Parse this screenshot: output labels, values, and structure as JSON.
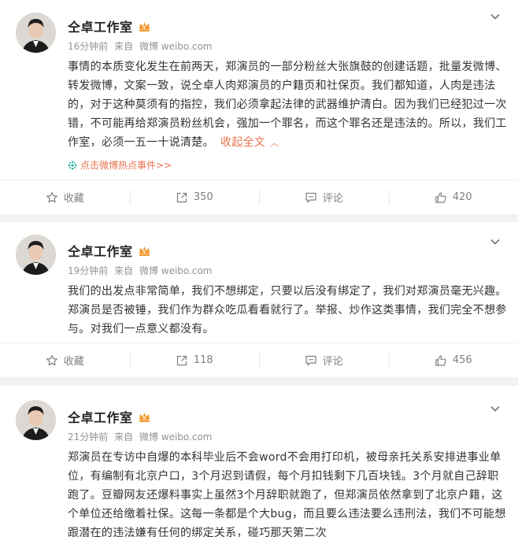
{
  "posts": [
    {
      "author": "仝卓工作室",
      "time": "16分钟前",
      "source_prefix": "来自",
      "source": "微博 weibo.com",
      "text": "事情的本质变化发生在前两天，郑演员的一部分粉丝大张旗鼓的创建话题，批量发微博、转发微博，文案一致，说仝卓人肉郑演员的户籍页和社保页。我们都知道，人肉是违法的，对于这种莫须有的指控，我们必须拿起法律的武器维护清白。因为我们已经犯过一次错，不可能再给郑演员粉丝机会，强加一个罪名，而这个罪名还是违法的。所以，我们工作室，必须一五一十说清楚。",
      "collapse_label": "收起全文",
      "hot_event": "点击微博热点事件>>",
      "actions": {
        "favorite": "收藏",
        "repost": "350",
        "comment": "评论",
        "like": "420"
      }
    },
    {
      "author": "仝卓工作室",
      "time": "19分钟前",
      "source_prefix": "来自",
      "source": "微博 weibo.com",
      "text": "我们的出发点非常简单，我们不想绑定，只要以后没有绑定了，我们对郑演员毫无兴趣。郑演员是否被锤，我们作为群众吃瓜看看就行了。举报、炒作这类事情，我们完全不想参与。对我们一点意义都没有。",
      "actions": {
        "favorite": "收藏",
        "repost": "118",
        "comment": "评论",
        "like": "456"
      }
    },
    {
      "author": "仝卓工作室",
      "time": "21分钟前",
      "source_prefix": "来自",
      "source": "微博 weibo.com",
      "text": "郑演员在专访中自爆的本科毕业后不会word不会用打印机，被母亲托关系安排进事业单位，有编制有北京户口，3个月迟到请假，每个月扣钱剩下几百块钱。3个月就自己辞职跑了。豆瓣网友还爆料事实上虽然3个月辞职就跑了，但郑演员依然拿到了北京户籍，这个单位还给缴着社保。这每一条都是个大bug，而且要么违法要么违刑法，我们不可能想跟潜在的违法嫌有任何的绑定关系，碰巧那天第二次"
    }
  ]
}
